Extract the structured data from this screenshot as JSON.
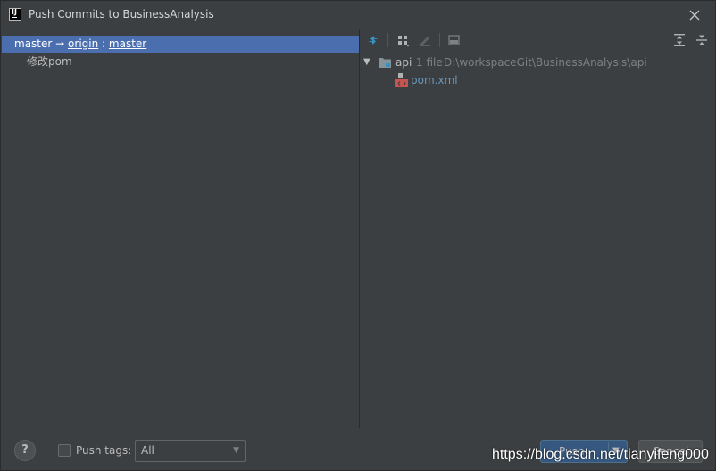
{
  "window": {
    "title": "Push Commits to BusinessAnalysis",
    "app_icon_text": "IJ",
    "close_icon": "close-icon"
  },
  "left": {
    "branch": {
      "local": "master",
      "arrow": "→",
      "remote": "origin",
      "sep": ":",
      "remote_branch": "master"
    },
    "commits": [
      "修改pom"
    ]
  },
  "right": {
    "toolbar_icons": [
      "show-diff-icon",
      "group-by-icon",
      "edit-icon",
      "commit-details-icon",
      "expand-all-icon",
      "collapse-all-icon"
    ],
    "tree": {
      "folder": {
        "name": "api",
        "count": "1 file",
        "path": "D:\\workspaceGit\\BusinessAnalysis\\api"
      },
      "files": [
        "pom.xml"
      ]
    }
  },
  "footer": {
    "help": "?",
    "push_tags_label": "Push tags:",
    "push_tags_select": "All",
    "push_button": "Push",
    "cancel_button": "Cancel"
  },
  "watermark": "https://blog.csdn.net/tianyifeng000",
  "colors": {
    "background": "#3c3f41",
    "selection": "#4b6eaf",
    "file_link": "#6897bb",
    "primary_button": "#365880"
  }
}
